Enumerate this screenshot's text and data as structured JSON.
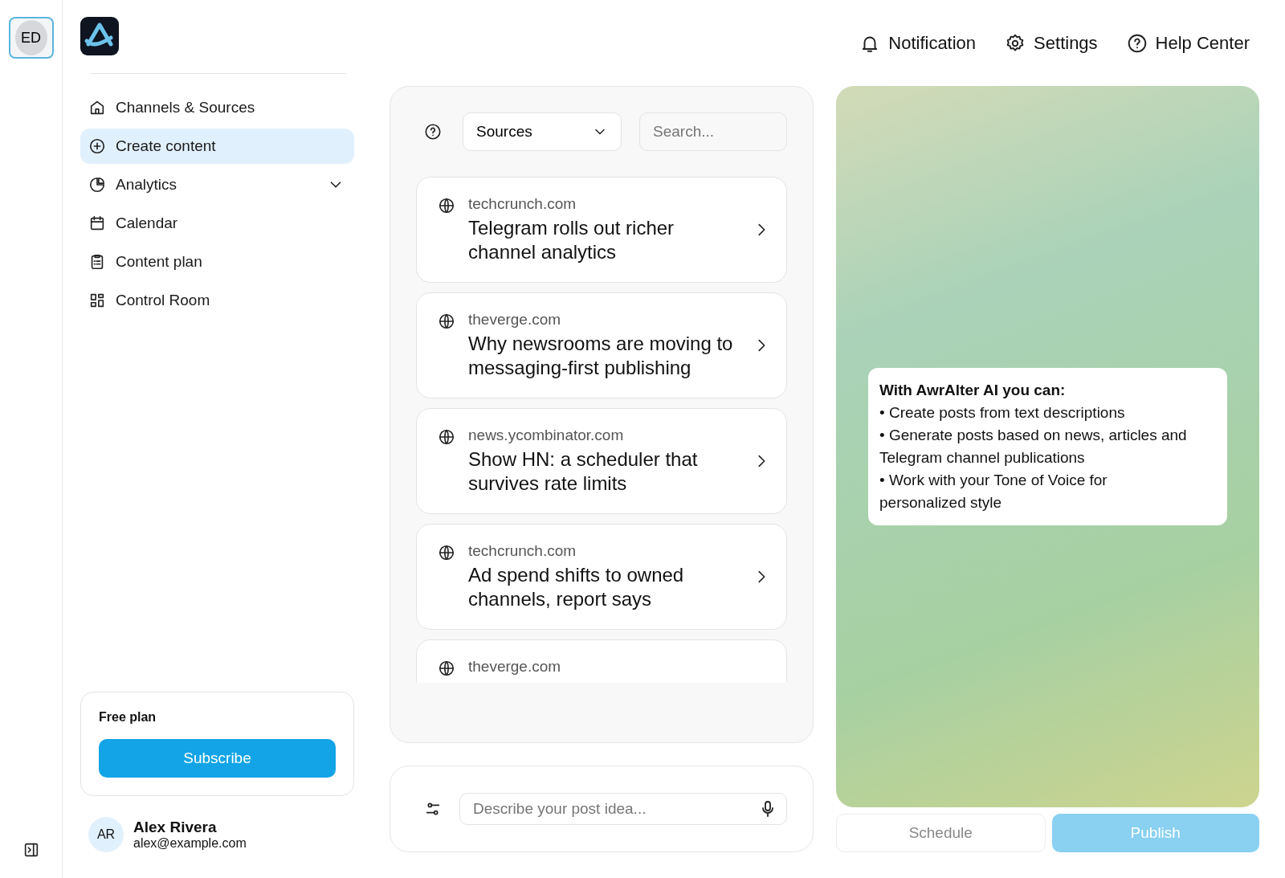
{
  "rail": {
    "avatar": "ED"
  },
  "sidebar": {
    "items": [
      {
        "label": "Channels & Sources",
        "selected": false,
        "kind": "link"
      },
      {
        "label": "Create content",
        "selected": true,
        "kind": "link"
      },
      {
        "label": "Analytics",
        "selected": false,
        "kind": "group"
      },
      {
        "label": "Calendar",
        "selected": false,
        "kind": "link"
      },
      {
        "label": "Content plan",
        "selected": false,
        "kind": "link"
      },
      {
        "label": "Control Room",
        "selected": false,
        "kind": "link"
      }
    ],
    "plan": {
      "title": "Free plan",
      "button": "Subscribe"
    },
    "user": {
      "initials": "AR",
      "name": "Alex Rivera",
      "email": "alex@example.com"
    }
  },
  "header": {
    "links": [
      {
        "label": "Notification"
      },
      {
        "label": "Settings"
      },
      {
        "label": "Help Center"
      }
    ]
  },
  "feed": {
    "filter": "Sources",
    "search": {
      "placeholder": "Search..."
    },
    "cards": [
      {
        "source": "techcrunch.com",
        "title": "Telegram rolls out richer channel analytics"
      },
      {
        "source": "theverge.com",
        "title": "Why newsrooms are moving to messaging-first publishing"
      },
      {
        "source": "news.ycombinator.com",
        "title": "Show HN: a scheduler that survives rate limits"
      },
      {
        "source": "techcrunch.com",
        "title": "Ad spend shifts to owned channels, report says"
      },
      {
        "source": "theverge.com"
      }
    ]
  },
  "composer": {
    "placeholder": "Describe your post idea..."
  },
  "preview": {
    "heading": "With AwrAlter AI you can:",
    "points": [
      "• Create posts from text descriptions",
      "• Generate posts based on news, articles and Telegram channel publications",
      "• Work with your Tone of Voice for personalized style"
    ]
  },
  "actions": [
    {
      "label": "Schedule",
      "kind": "secondary",
      "disabled": true
    },
    {
      "label": "Publish",
      "kind": "primary",
      "disabled": true
    }
  ]
}
